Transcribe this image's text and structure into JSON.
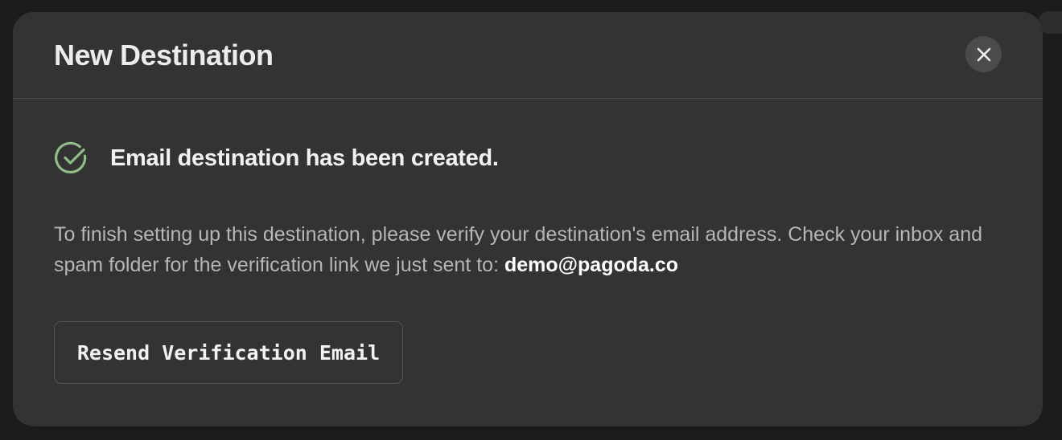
{
  "modal": {
    "title": "New Destination",
    "close_icon": "close-icon",
    "success": {
      "icon": "check-circle-icon",
      "icon_color": "#8fbf85",
      "message": "Email destination has been created."
    },
    "instructions": {
      "text": "To finish setting up this destination, please verify your destination's email address. Check your inbox and spam folder for the verification link we just sent to: ",
      "email": "demo@pagoda.co"
    },
    "resend_button_label": "Resend Verification Email"
  },
  "colors": {
    "modal_background": "#333333",
    "page_background": "#1c1c1d",
    "success_accent": "#8fbf85"
  }
}
